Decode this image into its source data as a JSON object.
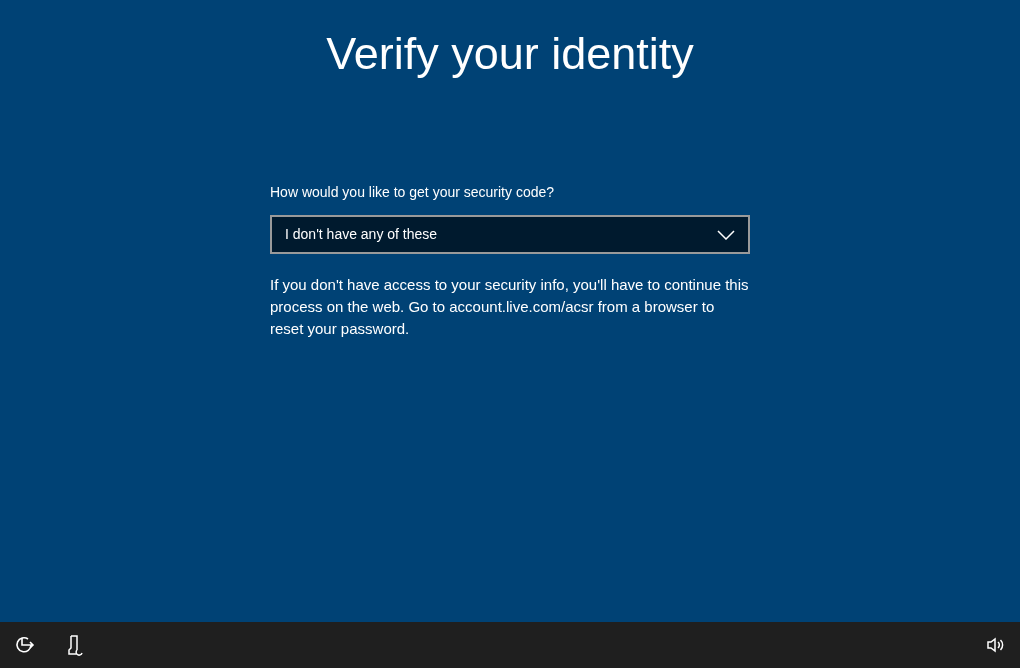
{
  "title": "Verify your identity",
  "question": "How would you like to get your security code?",
  "dropdown": {
    "value": "I don't have any of these"
  },
  "message": "If you don't have access to your security info, you'll have to continue this process on the web. Go to account.live.com/acsr from a browser to reset your password."
}
